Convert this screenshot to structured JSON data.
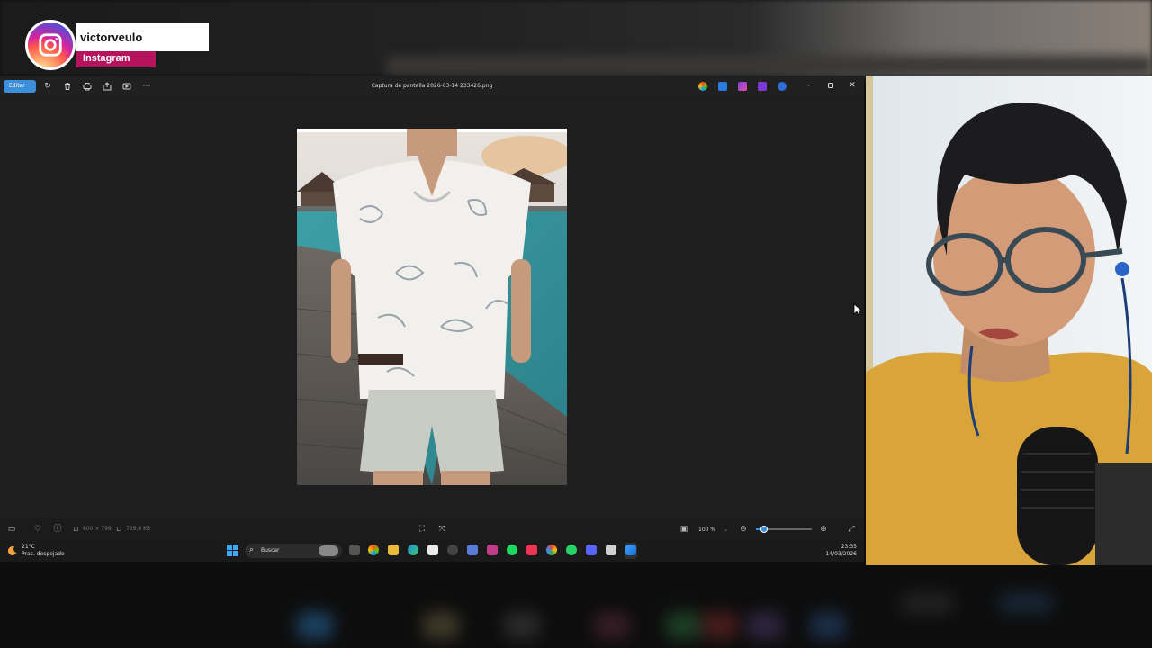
{
  "overlay": {
    "username": "victorveulo",
    "platform": "Instagram",
    "icon": "instagram-icon"
  },
  "window": {
    "title": "Captura de pantalla 2026-03-14 233426.png",
    "edit_label": "Editar",
    "toolbar_icons": [
      "rotate-icon",
      "delete-icon",
      "print-icon",
      "share-icon",
      "slideshow-icon",
      "more-icon"
    ],
    "app_icons": [
      "copilot-icon",
      "designer-icon",
      "clipchamp-icon",
      "clipchamp-video-icon",
      "onedrive-icon"
    ],
    "controls": [
      "minimize-icon",
      "maximize-icon",
      "close-icon"
    ]
  },
  "status": {
    "dimensions": "600 × 799",
    "filesize": "759,4 KB",
    "zoom": "100 %",
    "zoom_fraction": 0.15
  },
  "taskbar": {
    "temperature": "21°C",
    "weather": "Prac. despejado",
    "search_placeholder": "Buscar",
    "time": "23:35",
    "date": "14/03/2026"
  },
  "colors": {
    "accent": "#3c8fd8",
    "instagram_label": "#b5135b",
    "window_bg": "#1e1e1e"
  }
}
